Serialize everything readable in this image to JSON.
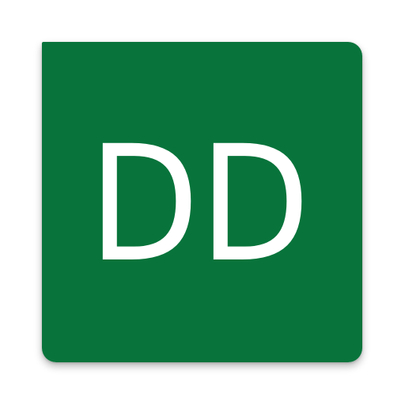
{
  "app_icon": {
    "monogram": "DD",
    "background_color": "#08743b",
    "text_color": "#ffffff"
  }
}
